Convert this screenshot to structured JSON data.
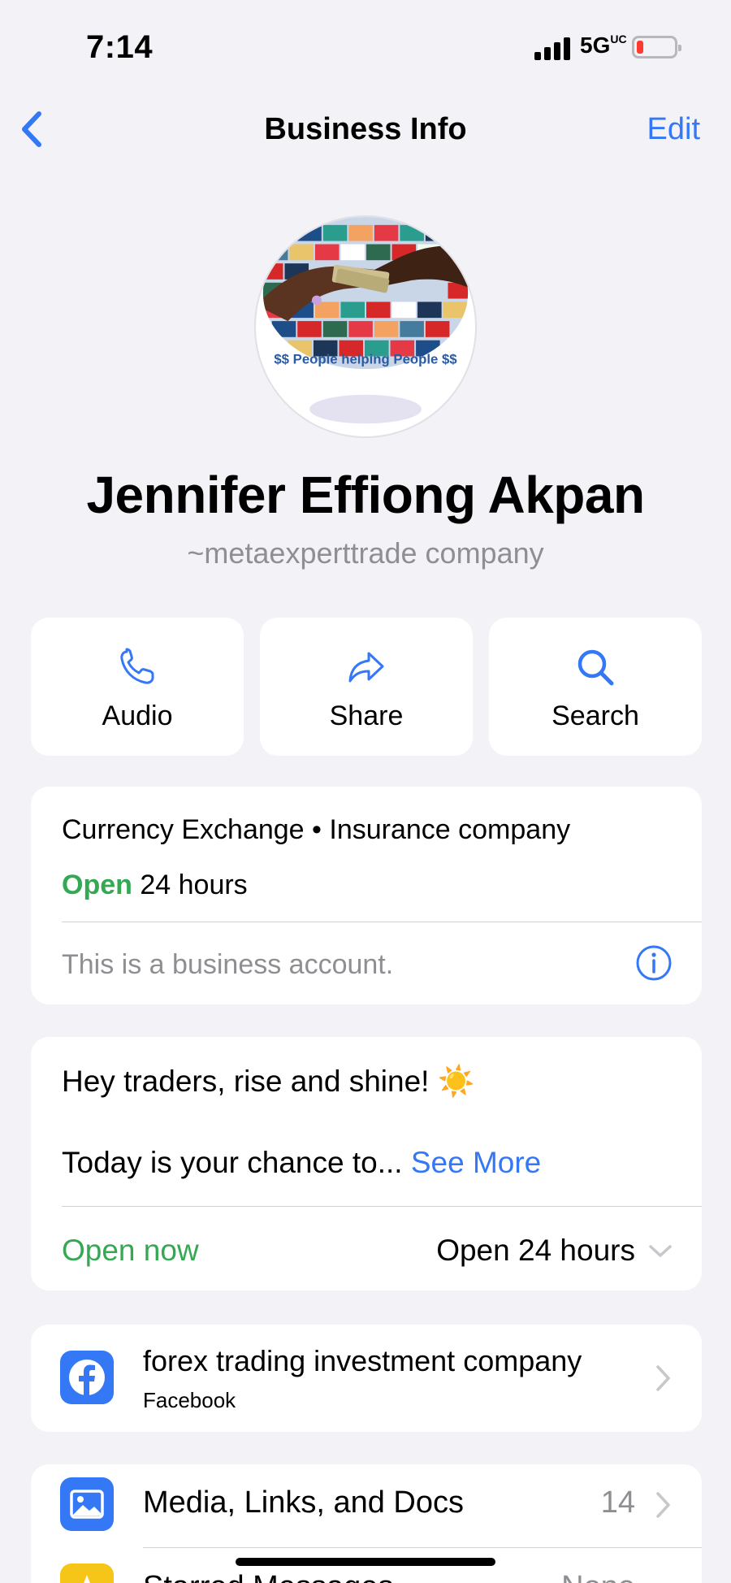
{
  "status_bar": {
    "time": "7:14",
    "network": "5G",
    "network_suffix": "UC"
  },
  "nav": {
    "title": "Business Info",
    "edit_label": "Edit"
  },
  "profile": {
    "avatar_banner_text": "$$ People helping People $$",
    "name": "Jennifer Effiong  Akpan",
    "subtitle": "~metaexperttrade company"
  },
  "actions": [
    {
      "label": "Audio",
      "icon": "phone-icon"
    },
    {
      "label": "Share",
      "icon": "share-arrow-icon"
    },
    {
      "label": "Search",
      "icon": "search-icon"
    }
  ],
  "business": {
    "categories": "Currency Exchange • Insurance company",
    "open_label": "Open",
    "hours": "24 hours",
    "account_note": "This is a business account."
  },
  "about": {
    "line1": "Hey traders, rise and shine! ☀️",
    "line2": "Today is your chance to...",
    "see_more": "See More",
    "open_now": "Open now",
    "hours": "Open 24 hours"
  },
  "facebook": {
    "title": "forex trading investment company",
    "subtitle": "Facebook"
  },
  "media": {
    "label": "Media, Links, and Docs",
    "count": "14",
    "starred_label": "Starred Messages",
    "starred_value": "None"
  },
  "colors": {
    "accent": "#3478f6",
    "green": "#34a853",
    "background": "#f2f2f7"
  }
}
